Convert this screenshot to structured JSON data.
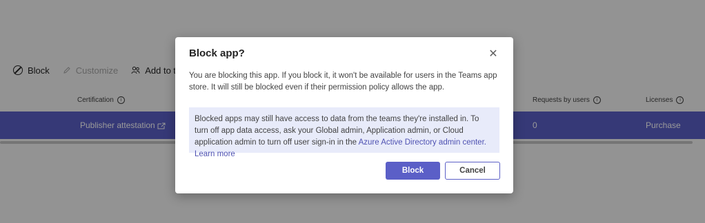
{
  "toolbar": {
    "block_label": "Block",
    "customize_label": "Customize",
    "add_to_team_label": "Add to tea"
  },
  "table": {
    "headers": {
      "certification": "Certification",
      "requests": "Requests by users",
      "licenses": "Licenses"
    },
    "row": {
      "certification": "Publisher attestation",
      "requests": "0",
      "licenses": "Purchase"
    }
  },
  "dialog": {
    "title": "Block app?",
    "body": "You are blocking this app. If you block it, it won't be available for users in the Teams app store. It will still be blocked even if their permission policy allows the app.",
    "info_text": "Blocked apps may still have access to data from the teams they're installed in. To turn off app data access, ask your Global admin, Application admin, or Cloud application admin to turn off user sign-in in the ",
    "info_link": "Azure Active Directory admin center.",
    "learn_more": "Learn more",
    "primary_button": "Block",
    "secondary_button": "Cancel"
  },
  "colors": {
    "accent": "#5b5fc7",
    "info_bg": "#e8ebfa",
    "overlay": "rgba(0,0,0,0.4)"
  },
  "icons": {
    "block": "circle-slash-icon",
    "customize": "pencil-icon",
    "add_to_team": "people-icon",
    "info": "info-icon",
    "open_external": "open-external-icon",
    "close": "close-icon"
  }
}
